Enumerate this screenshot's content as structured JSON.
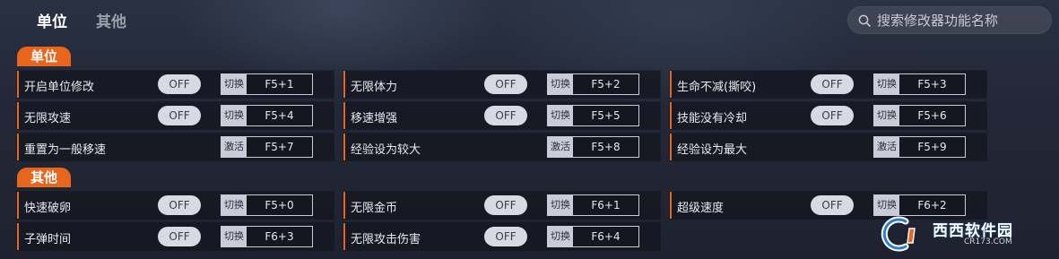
{
  "tabs": [
    {
      "label": "单位"
    },
    {
      "label": "其他"
    }
  ],
  "search": {
    "placeholder": "搜索修改器功能名称"
  },
  "sections": [
    {
      "title": "单位"
    },
    {
      "title": "其他"
    }
  ],
  "items": [
    {
      "label": "开启单位修改",
      "toggle": "OFF",
      "action": "切换",
      "key": "F5+1"
    },
    {
      "label": "无限体力",
      "toggle": "OFF",
      "action": "切换",
      "key": "F5+2"
    },
    {
      "label": "生命不减(撕咬)",
      "toggle": "OFF",
      "action": "切换",
      "key": "F5+3"
    },
    {
      "label": "无限攻速",
      "toggle": "OFF",
      "action": "切换",
      "key": "F5+4"
    },
    {
      "label": "移速增强",
      "toggle": "OFF",
      "action": "切换",
      "key": "F5+5"
    },
    {
      "label": "技能没有冷却",
      "toggle": "OFF",
      "action": "切换",
      "key": "F5+6"
    },
    {
      "label": "重置为一般移速",
      "action": "激活",
      "key": "F5+7"
    },
    {
      "label": "经验设为较大",
      "action": "激活",
      "key": "F5+8"
    },
    {
      "label": "经验设为最大",
      "action": "激活",
      "key": "F5+9"
    },
    {
      "label": "快速破卵",
      "toggle": "OFF",
      "action": "切换",
      "key": "F5+0"
    },
    {
      "label": "无限金币",
      "toggle": "OFF",
      "action": "切换",
      "key": "F6+1"
    },
    {
      "label": "超级速度",
      "toggle": "OFF",
      "action": "切换",
      "key": "F6+2"
    },
    {
      "label": "子弹时间",
      "toggle": "OFF",
      "action": "切换",
      "key": "F6+3"
    },
    {
      "label": "无限攻击伤害",
      "toggle": "OFF",
      "action": "切换",
      "key": "F6+4"
    }
  ],
  "watermark": {
    "text": "西西软件园",
    "sub": "CR173.COM"
  },
  "colors": {
    "accent": "#e8661c",
    "row_bg": "#16181f",
    "toggle_bg": "#d7dae2"
  }
}
